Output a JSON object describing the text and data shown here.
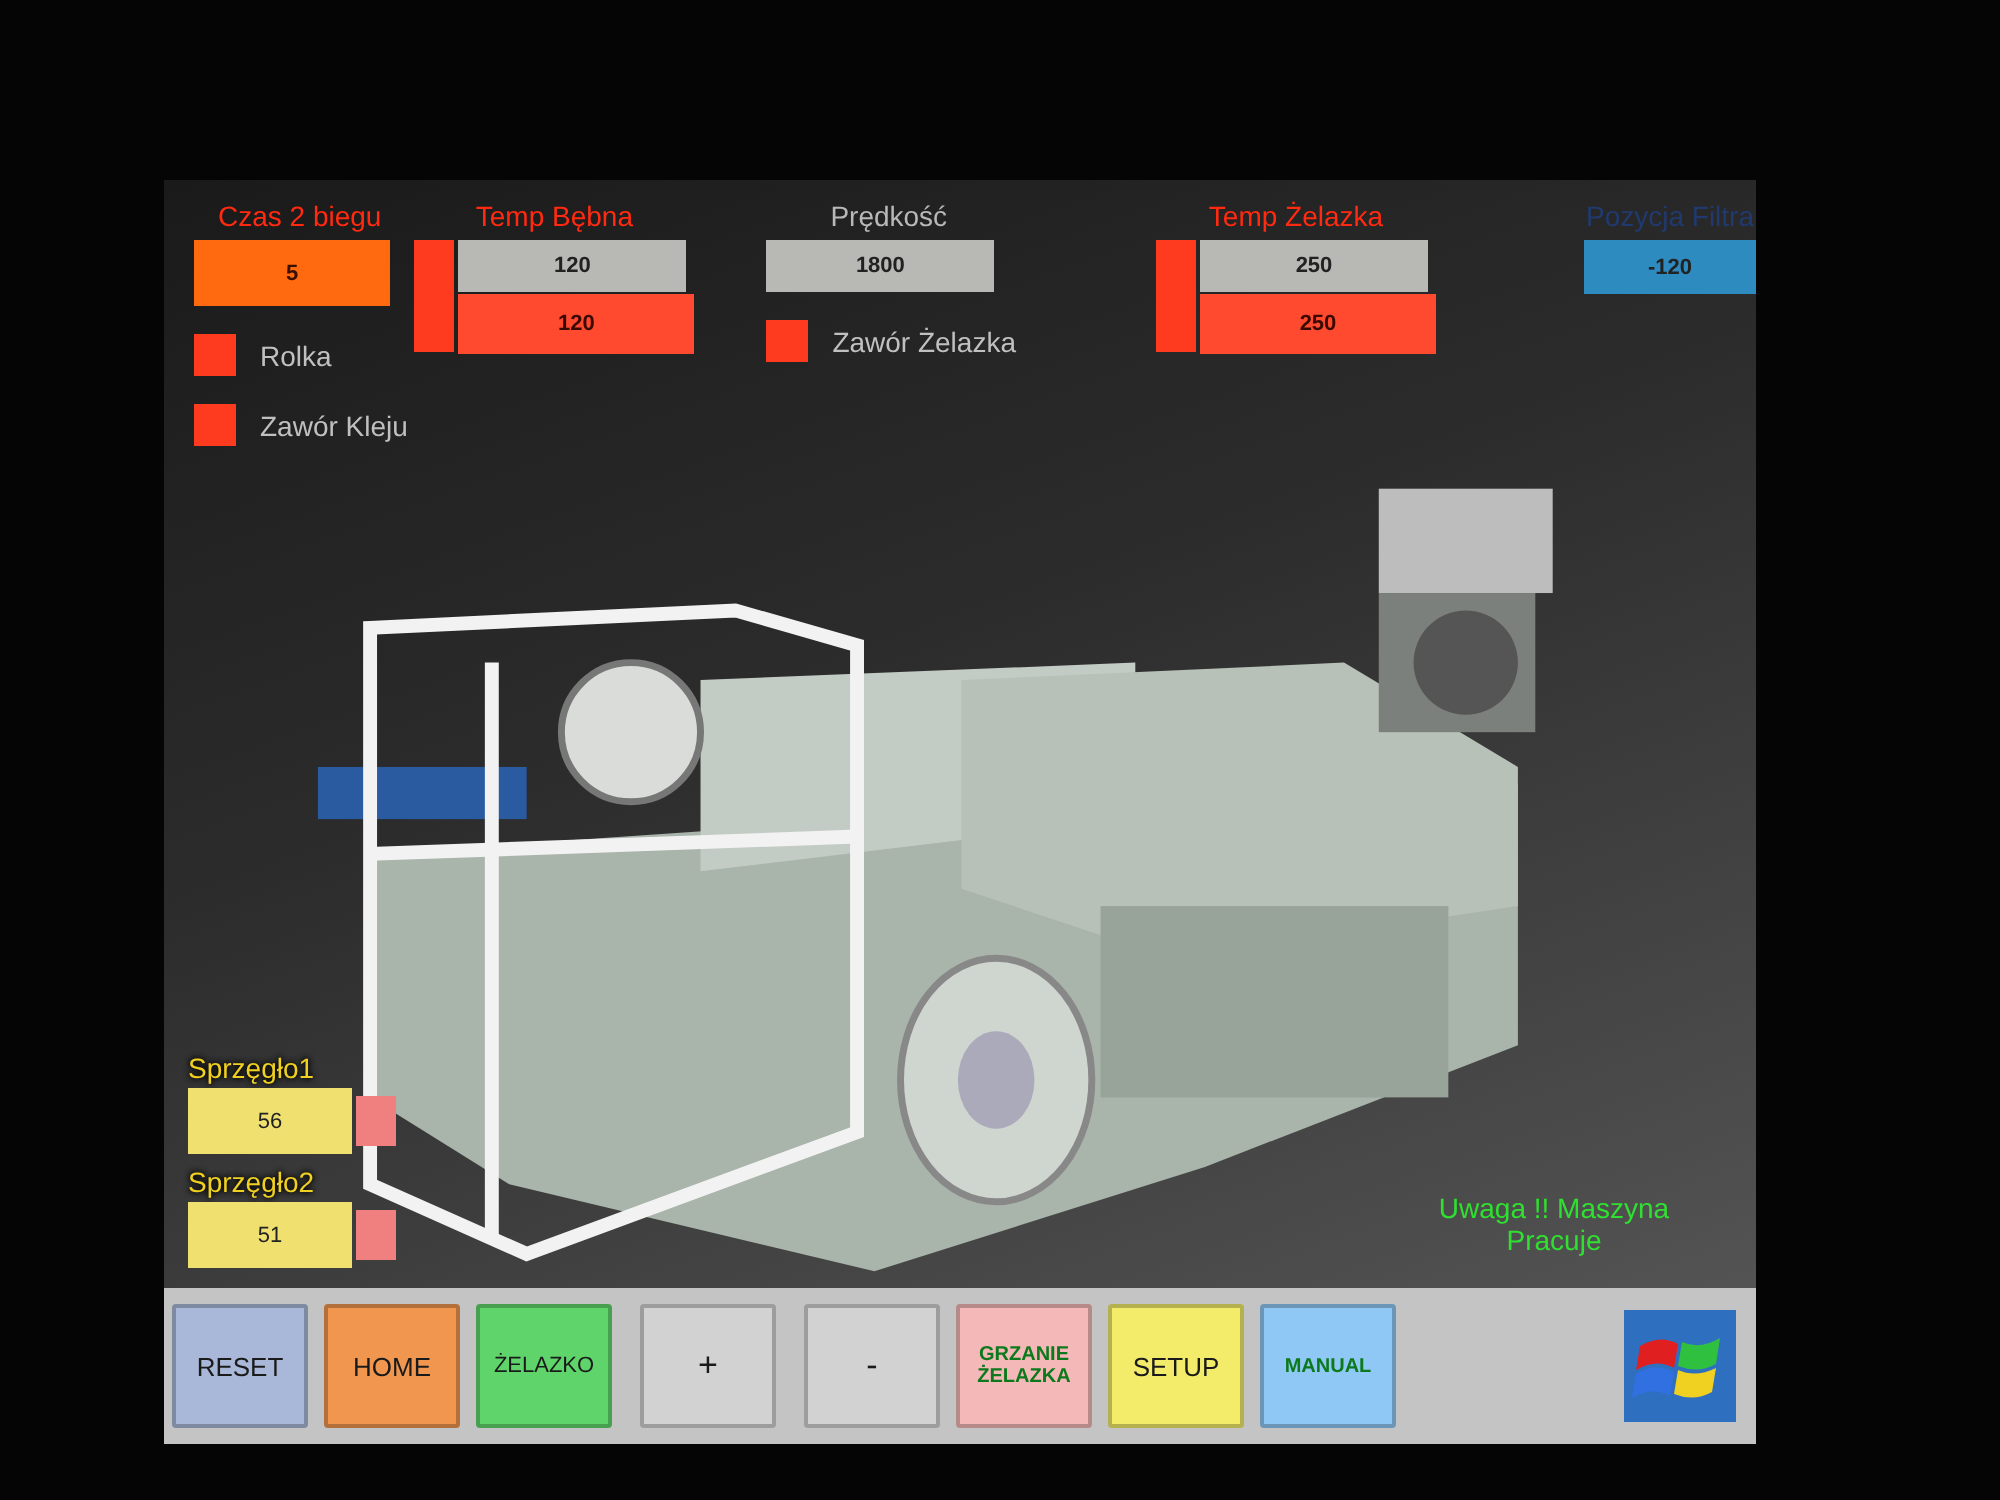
{
  "czas": {
    "label": "Czas 2 biegu",
    "value": "5"
  },
  "temp_bebna": {
    "label": "Temp Bębna",
    "setpoint": "120",
    "actual": "120",
    "heating": true
  },
  "predkosc": {
    "label": "Prędkość",
    "value": "1800"
  },
  "temp_zelazka": {
    "label": "Temp Żelazka",
    "setpoint": "250",
    "actual": "250",
    "heating": true
  },
  "pozycja_filtra": {
    "label": "Pozycja Filtra",
    "value": "-120"
  },
  "lamps": [
    {
      "label": "Rolka",
      "on": true
    },
    {
      "label": "Zawór Kleju",
      "on": true
    }
  ],
  "zawor_zelazka": {
    "label": "Zawór Żelazka",
    "on": true
  },
  "couplings": [
    {
      "label": "Sprzęgło1",
      "value": "56",
      "on": true
    },
    {
      "label": "Sprzęgło2",
      "value": "51",
      "on": true
    }
  ],
  "warning": "Uwaga !! Maszyna Pracuje",
  "buttons": [
    {
      "label": "RESET",
      "color": "#a9b8d8"
    },
    {
      "label": "HOME",
      "color": "#f0964f"
    },
    {
      "label": "ŻELAZKO",
      "color": "#5fd46a"
    },
    {
      "label": "+",
      "color": "#d2d2d2"
    },
    {
      "label": "-",
      "color": "#d2d2d2"
    },
    {
      "label": "GRZANIE ŻELAZKA",
      "color": "#f5b8b8"
    },
    {
      "label": "SETUP",
      "color": "#f2ec6a"
    },
    {
      "label": "MANUAL",
      "color": "#8fc8f5"
    }
  ]
}
